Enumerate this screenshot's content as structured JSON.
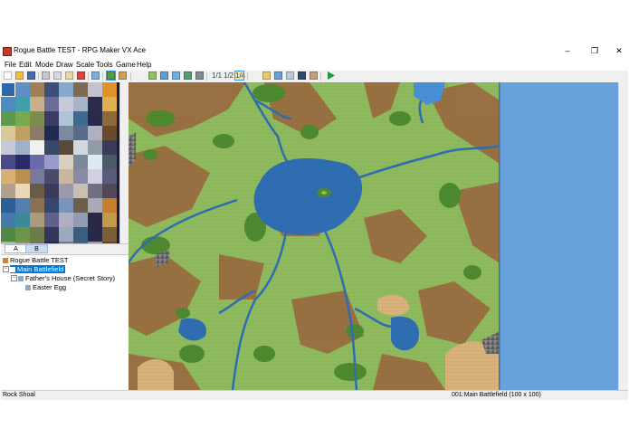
{
  "window": {
    "title": "Rogue Battle TEST - RPG Maker VX Ace",
    "controls": [
      "minimize-icon",
      "maximize-icon",
      "close-icon"
    ]
  },
  "menu": {
    "items": [
      "File",
      "Edit",
      "Mode",
      "Draw",
      "Scale",
      "Tools",
      "Game",
      "Help"
    ]
  },
  "toolbar": {
    "icons": [
      "new-project-icon",
      "open-project-icon",
      "save-icon",
      "cut-icon",
      "copy-icon",
      "paste-icon",
      "delete-icon",
      "undo-icon",
      "layer-map-icon",
      "layer-event-icon",
      "pencil-icon",
      "rectangle-icon",
      "ellipse-icon",
      "flood-fill-icon",
      "shadow-pen-icon",
      "zoom-1-1-icon",
      "zoom-1-2-icon",
      "zoom-1-4-icon",
      "database-icon",
      "resource-manager-icon",
      "script-editor-icon",
      "sound-test-icon",
      "character-generator-icon",
      "playtest-icon"
    ],
    "zoom_1_1": "1/1",
    "zoom_1_2": "1/2",
    "zoom_1_4": "1/4"
  },
  "tileset_palette": {
    "tiles": [
      "#2f6aa8",
      "#5e8fc4",
      "#a08056",
      "#3a4f7a",
      "#88a9cf",
      "#7d6a50",
      "#c2c2d0",
      "#e0912a",
      "#4c8cc0",
      "#3ea0a8",
      "#c7b08a",
      "#6c6c9a",
      "#c9c9d9",
      "#a7b4c9",
      "#2c2c48",
      "#e0b050",
      "#5a9a4a",
      "#7aa84e",
      "#7d8d4d",
      "#3b3b63",
      "#b0c4d8",
      "#3d6b8d",
      "#2a2a4a",
      "#8a6a3a",
      "#d8c89a",
      "#c0a060",
      "#8a7a6a",
      "#1e2a50",
      "#7a8aa0",
      "#5a6a8a",
      "#b0b0c0",
      "#6a4a2a",
      "#c8c8d8",
      "#a0b0c8",
      "#f0f0f0",
      "#384868",
      "#5a4838",
      "#d0d8e0",
      "#909aa8",
      "#3a3a5a",
      "#4a4a8a",
      "#2a2a6a",
      "#6a6aaa",
      "#9a9aca",
      "#d8d0c0",
      "#7a8a9a",
      "#e0e8f0",
      "#4a5a6a",
      "#d8b070",
      "#b89050",
      "#7a7a9a",
      "#4a4a6a",
      "#c8b8a0",
      "#8a8aa8",
      "#d0d0e0",
      "#5a5a7a",
      "#b0a090",
      "#e8d8b8",
      "#6a5a4a",
      "#3a3a5a",
      "#9a9aaa",
      "#c8c0b0",
      "#707080",
      "#504858"
    ],
    "selected_index": 0
  },
  "tabs": [
    "A",
    "B"
  ],
  "map_tree": {
    "project": "Rogue Battle TEST",
    "items": [
      {
        "label": "Main Battlefield",
        "level": 1,
        "selected": true
      },
      {
        "label": "Father's House (Secret Story)",
        "level": 2,
        "selected": false
      },
      {
        "label": "Easter Egg",
        "level": 3,
        "selected": false
      }
    ]
  },
  "map": {
    "name": "Main Battlefield",
    "width_tiles": 100,
    "height_tiles": 100
  },
  "statusbar": {
    "tile_name": "Rock Shoal",
    "map_info": "001:Main Battlefield (100 x 100)"
  },
  "colors": {
    "grass": "#8fba5e",
    "forest": "#4e8a2f",
    "dirt": "#9b6a40",
    "water": "#2f6eb3",
    "sea": "#6aa5e0",
    "sand": "#d9b37a",
    "selection": "#0078d7"
  }
}
